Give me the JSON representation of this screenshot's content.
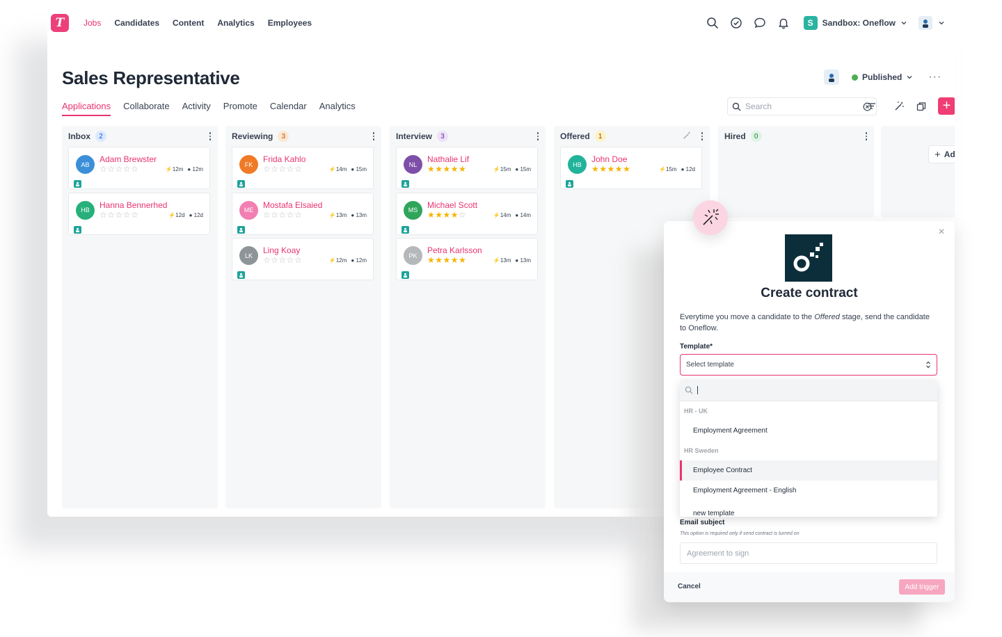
{
  "app": {
    "logo_letter": "T",
    "nav": [
      "Jobs",
      "Candidates",
      "Content",
      "Analytics",
      "Employees"
    ],
    "org_badge": "S",
    "org_name": "Sandbox: Oneflow"
  },
  "job": {
    "title": "Sales Representative",
    "status": "Published",
    "tabs": [
      "Applications",
      "Collaborate",
      "Activity",
      "Promote",
      "Calendar",
      "Analytics"
    ],
    "search_placeholder": "Search"
  },
  "columns": [
    {
      "name": "Inbox",
      "count": "2",
      "cards": [
        {
          "initials": "AB",
          "name": "Adam Brewster",
          "rating": 0,
          "m1": "12m",
          "m2": "12m",
          "color": "#3b8fd9"
        },
        {
          "initials": "HB",
          "name": "Hanna Bennerhed",
          "rating": 0,
          "m1": "12d",
          "m2": "12d",
          "color": "#27b07a"
        }
      ]
    },
    {
      "name": "Reviewing",
      "count": "3",
      "cards": [
        {
          "initials": "FK",
          "name": "Frida Kahlo",
          "rating": 0,
          "m1": "14m",
          "m2": "15m",
          "color": "#f07a26"
        },
        {
          "initials": "ME",
          "name": "Mostafa Elsaied",
          "rating": 0,
          "m1": "13m",
          "m2": "13m",
          "color": "#f27fb1"
        },
        {
          "initials": "LK",
          "name": "Ling Koay",
          "rating": 0,
          "m1": "12m",
          "m2": "12m",
          "color": "#8e9598"
        }
      ]
    },
    {
      "name": "Interview",
      "count": "3",
      "cards": [
        {
          "initials": "NL",
          "name": "Nathalie Lif",
          "rating": 5,
          "m1": "15m",
          "m2": "15m",
          "color": "#7e4fa8"
        },
        {
          "initials": "MS",
          "name": "Michael Scott",
          "rating": 4,
          "m1": "14m",
          "m2": "14m",
          "color": "#2fa55a"
        },
        {
          "initials": "PK",
          "name": "Petra Karlsson",
          "rating": 5,
          "m1": "13m",
          "m2": "13m",
          "color": "#b5b8bb"
        }
      ]
    },
    {
      "name": "Offered",
      "count": "1",
      "cards": [
        {
          "initials": "HB",
          "name": "John Doe",
          "rating": 5,
          "m1": "15m",
          "m2": "12d",
          "color": "#22b39a"
        }
      ]
    },
    {
      "name": "Hired",
      "count": "0",
      "cards": []
    }
  ],
  "add_stage_label": "Ad",
  "modal": {
    "title": "Create contract",
    "desc_before": "Everytime you move a candidate to the ",
    "desc_em": "Offered",
    "desc_after": " stage, send the candidate to Oneflow.",
    "template_label": "Template*",
    "template_value": "Select template",
    "dropdown": {
      "group1": "HR - UK",
      "item1": "Employment Agreement",
      "group2": "HR Sweden",
      "item2": "Employee Contract",
      "item3": "Employment Agreement - English",
      "item4": "new template"
    },
    "email_label": "Email subject",
    "email_hint": "This option is required only if send contract is turned on",
    "email_placeholder": "Agreement to sign",
    "cancel": "Cancel",
    "add_trigger": "Add trigger"
  },
  "colors": {
    "accent": "#e8336f",
    "oneflow_bg": "#0b2e3a",
    "star": "#f5b400"
  }
}
